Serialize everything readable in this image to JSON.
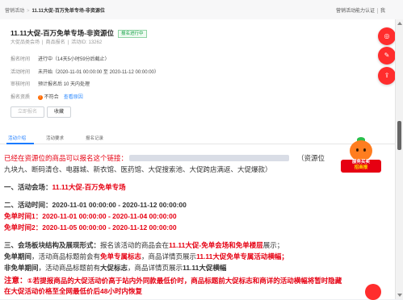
{
  "breadcrumb": {
    "root": "营销活动",
    "sep": ">",
    "current": "11.11大促-百万免单专场-非资源位"
  },
  "top_right": {
    "link": "营销活动能力认证",
    "avatar_label": "我"
  },
  "activity": {
    "title": "11.11大促-百万免单专场-非资源位",
    "status_badge": "报名进行中",
    "type": "大促品类会场",
    "form": "商品报名",
    "id_text": "活动ID: 13262"
  },
  "info": [
    {
      "key": "报名时间",
      "value": "进行中（14天5小时59分后截止）"
    },
    {
      "key": "活动时间",
      "value": "未开始（2020-11-01 00:00:00 至 2020-11-12 00:00:00）"
    },
    {
      "key": "审核时间",
      "value": "预计报名后 10 天内处理"
    },
    {
      "key": "报名资质",
      "value": "不符合",
      "link": "查看原因"
    }
  ],
  "buttons": {
    "apply": "立即报名",
    "favorite": "收藏"
  },
  "tabs": [
    "活动介绍",
    "活动要求",
    "报名记录"
  ],
  "content": {
    "line1_pre": "已经在资源位的商品可以报名这个链接：",
    "line1_post": "（资源位",
    "line1_trail": "九块九、断码清仓、电器城、新衣馆、医药馆、大促搜索池、大促跨店满返、大促爆款）",
    "s1_label": "一、活动会场：",
    "s1_value": "11.11大促-百万免单专场",
    "s2_label": "二、活动时间：",
    "s2_value": "2020-11-01 00:00:00 - 2020-11-12 00:00:00",
    "free1": "免单时间1：2020-11-01 00:00:00 - 2020-11-04 00:00:00",
    "free2": "免单时间2：2020-11-05 00:00:00 - 2020-11-12 00:00:00",
    "s3_a": "三、会场板块结构及展现形式：",
    "s3_b": "报名该活动的商品会在",
    "s3_c": "11.11大促-免单会场和免单楼层",
    "s3_d": "展示；",
    "p1_a": "免单期间",
    "p1_b": "，活动商品标题前会有",
    "p1_c": "免单专属标志",
    "p1_d": "，商品详情页展示",
    "p1_e": "11.11大促免单专属活动横幅；",
    "p2_a": "非免单期间",
    "p2_b": "，活动商品标题前有",
    "p2_c": "大促标志",
    "p2_d": "，商品详情页展示",
    "p2_e": "11.11大促横幅",
    "note_a": "注意：",
    "note_b": "①若提报商品的大促活动价高于站内外同款最低价时，商品标题前大促标志和商详的活动横幅将暂时隐藏",
    "note_c": "在大促活动价格至全网最低价后48小时内恢复"
  },
  "promo": {
    "line1": "服务买卖",
    "line2": "招商报"
  }
}
